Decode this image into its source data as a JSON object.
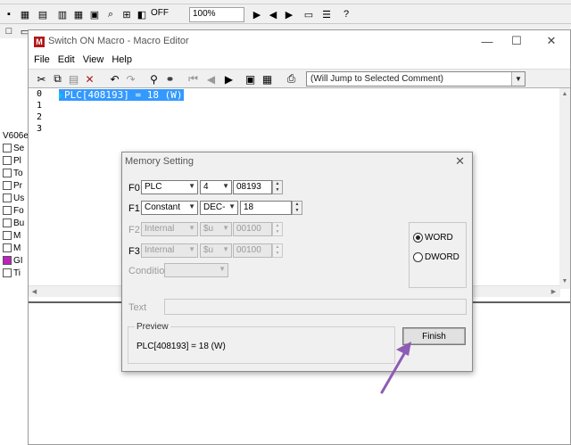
{
  "macro_editor": {
    "title": "Switch ON Macro - Macro Editor",
    "title_icon": "M",
    "menu": [
      "File",
      "Edit",
      "View",
      "Help"
    ],
    "comment_jump": "(Will Jump to Selected Comment)",
    "line_numbers": [
      "0",
      "1",
      "2",
      "3"
    ],
    "code_line": "PLC[408193] = 18 (W)"
  },
  "background_app": {
    "toolbar_off_label": "OFF",
    "zoom": "100%",
    "tree_prefix": "V606e",
    "tree_items": [
      "Se",
      "Pl",
      "To",
      "Pr",
      "Us",
      "Fo",
      "Bu",
      "M",
      "M",
      "GI",
      "Ti"
    ]
  },
  "memory_dialog": {
    "title": "Memory Setting",
    "f0": {
      "label": "F0",
      "device": "PLC",
      "format": "4",
      "address": "08193"
    },
    "f1": {
      "label": "F1",
      "device": "Constant",
      "format": "DEC-",
      "value": "18"
    },
    "f2": {
      "label": "F2",
      "device": "Internal",
      "format": "$u",
      "address": "00100"
    },
    "f3": {
      "label": "F3",
      "device": "Internal",
      "format": "$u",
      "address": "00100"
    },
    "condition_label": "Condition",
    "word_label": "WORD",
    "dword_label": "DWORD",
    "selected_size": "WORD",
    "text_label": "Text",
    "preview_label": "Preview",
    "preview_text": "PLC[408193] = 18 (W)",
    "finish_label": "Finish"
  },
  "colors": {
    "selection": "#3399ff",
    "arrow": "#8e5bb5",
    "title_icon": "#b01818"
  }
}
